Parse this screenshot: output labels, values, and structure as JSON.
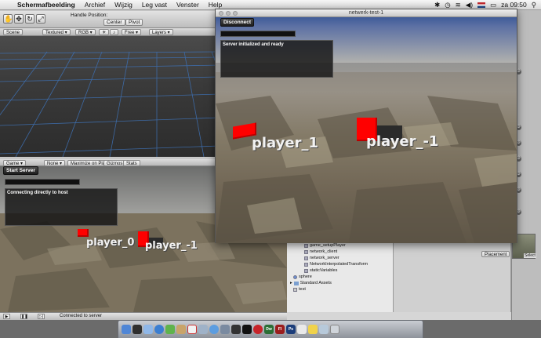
{
  "menubar": {
    "app_name": "Schermafbeelding",
    "items": [
      "Archief",
      "Wijzig",
      "Leg vast",
      "Venster",
      "Help"
    ],
    "clock": "za 09:50"
  },
  "editor": {
    "toolbar": {
      "handle_position_label": "Handle Position:",
      "center_label": "Center",
      "pivot_label": "Pivot"
    },
    "scene_bar": {
      "scene_tab": "Scene",
      "render_mode": "Textured",
      "color_mode": "RGB",
      "free_label": "Free",
      "layers_label": "Layers"
    },
    "game_bar": {
      "game_tab": "Game",
      "aspect": "None",
      "maximize_on_play": "Maximize on Play",
      "gizmos": "Gizmos",
      "stats": "Stats"
    },
    "game_view": {
      "start_server_button": "Start Server",
      "status_box_text": "Connecting directly to host",
      "players": [
        {
          "label": "player_0"
        },
        {
          "label": "player_-1"
        }
      ]
    },
    "status_bar": {
      "message": "Connected to server"
    },
    "project": {
      "items": [
        {
          "label": "game_setupPlayer",
          "kind": "script"
        },
        {
          "label": "network_client",
          "kind": "script"
        },
        {
          "label": "network_server",
          "kind": "script"
        },
        {
          "label": "NetworkInterpolatedTransform",
          "kind": "script"
        },
        {
          "label": "staticVariables",
          "kind": "script"
        },
        {
          "label": "sphere",
          "kind": "prefab"
        },
        {
          "label": "Standard Assets",
          "kind": "folder"
        },
        {
          "label": "test",
          "kind": "scene"
        }
      ]
    },
    "inspector": {
      "placement_button": "Placement",
      "select_label": "Select"
    }
  },
  "network_window": {
    "title": "netwerk-test-1",
    "disconnect_button": "Disconnect",
    "status_box_text": "Server initialized and ready",
    "players": [
      {
        "label": "player_1"
      },
      {
        "label": "player_-1"
      }
    ]
  },
  "colors": {
    "cube_red": "#ff0000",
    "sky_blue": "#3f5b98",
    "unity_dark": "#1e1e1e"
  },
  "dock": {
    "icons": [
      "finder-icon",
      "dashboard-icon",
      "mail-icon",
      "safari-icon",
      "ichat-icon",
      "addressbook-icon",
      "ical-icon",
      "preview-icon",
      "itunes-icon",
      "iphoto-icon",
      "unity-icon",
      "terminal-icon",
      "activity-icon",
      "dreamweaver-icon",
      "flash-icon",
      "photoshop-icon",
      "misc-icon",
      "misc-icon-2",
      "misc-icon-3",
      "trash-icon"
    ],
    "labels": {
      "dreamweaver": "Dw",
      "flash": "Fl",
      "photoshop": "Ps"
    }
  }
}
